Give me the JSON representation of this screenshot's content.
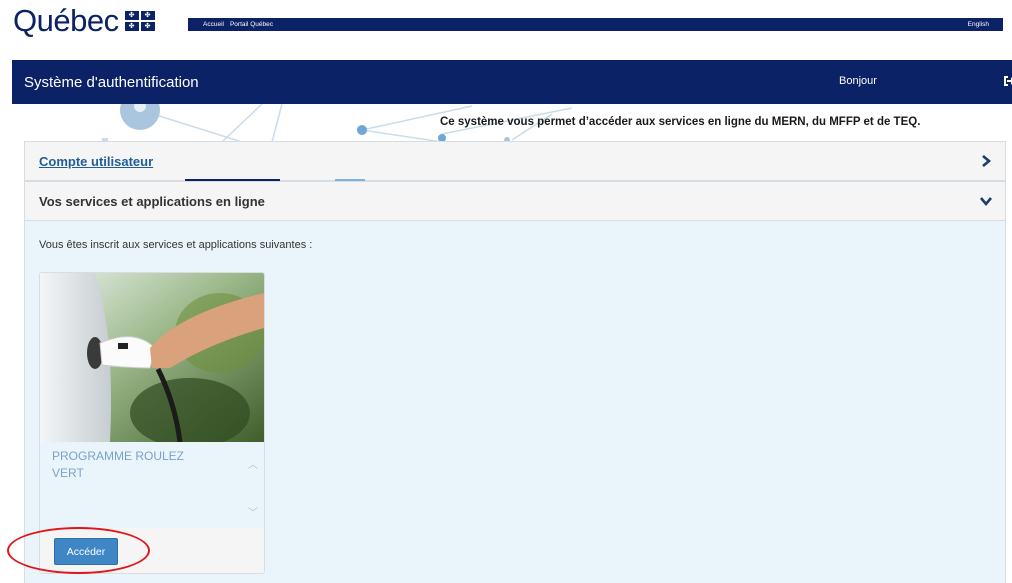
{
  "gov": {
    "logo_text": "Québec",
    "nav_home": "Accueil",
    "nav_portal": "Portail Québec",
    "language_link": "English"
  },
  "auth": {
    "title": "Système d'authentification",
    "greeting": "Bonjour"
  },
  "banner": {
    "tagline": "Ce système vous permet d’accéder aux services en ligne du MERN, du MFFP et de TEQ."
  },
  "account_panel": {
    "label": "Compte utilisateur",
    "state": "collapsed"
  },
  "services_panel": {
    "label": "Vos services et applications en ligne",
    "state": "expanded",
    "intro": "Vous êtes inscrit aux services et applications suivantes :",
    "cards": [
      {
        "title": "PROGRAMME ROULEZ VERT",
        "button_label": "Accéder"
      }
    ]
  },
  "colors": {
    "navy": "#0b2266",
    "link_blue": "#1f5e96",
    "button_blue": "#3e86c6",
    "highlight_red": "#e0161b"
  }
}
